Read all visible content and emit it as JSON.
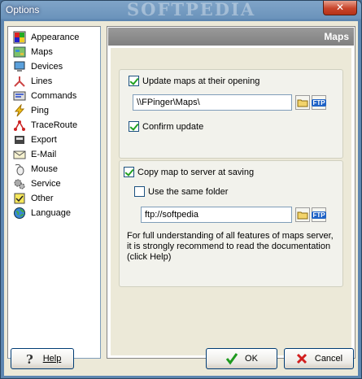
{
  "window": {
    "title": "Options",
    "watermark": "SOFTPEDIA",
    "close_label": "✕"
  },
  "nav": {
    "items": [
      {
        "label": "Appearance",
        "icon": "palette-icon"
      },
      {
        "label": "Maps",
        "icon": "map-icon"
      },
      {
        "label": "Devices",
        "icon": "computer-icon"
      },
      {
        "label": "Lines",
        "icon": "lines-icon"
      },
      {
        "label": "Commands",
        "icon": "commands-icon"
      },
      {
        "label": "Ping",
        "icon": "lightning-icon"
      },
      {
        "label": "TraceRoute",
        "icon": "traceroute-icon"
      },
      {
        "label": "Export",
        "icon": "export-icon"
      },
      {
        "label": "E-Mail",
        "icon": "email-icon"
      },
      {
        "label": "Mouse",
        "icon": "mouse-icon"
      },
      {
        "label": "Service",
        "icon": "gears-icon"
      },
      {
        "label": "Other",
        "icon": "checklist-icon"
      },
      {
        "label": "Language",
        "icon": "globe-icon"
      }
    ]
  },
  "panel": {
    "header": "Maps",
    "update_maps": {
      "label": "Update maps at their opening",
      "checked": true
    },
    "maps_path": "\\\\FPinger\\Maps\\",
    "confirm_update": {
      "label": "Confirm update",
      "checked": true
    },
    "copy_map": {
      "label": "Copy map to server at saving",
      "checked": true
    },
    "same_folder": {
      "label": "Use the same folder",
      "checked": false
    },
    "server_path": "ftp://softpedia",
    "ftp_label": "FTP",
    "note": "For full understanding of all features of maps server,\nit is strongly recommend to read the documentation\n(click Help)"
  },
  "buttons": {
    "help": "Help",
    "ok": "OK",
    "cancel": "Cancel"
  }
}
